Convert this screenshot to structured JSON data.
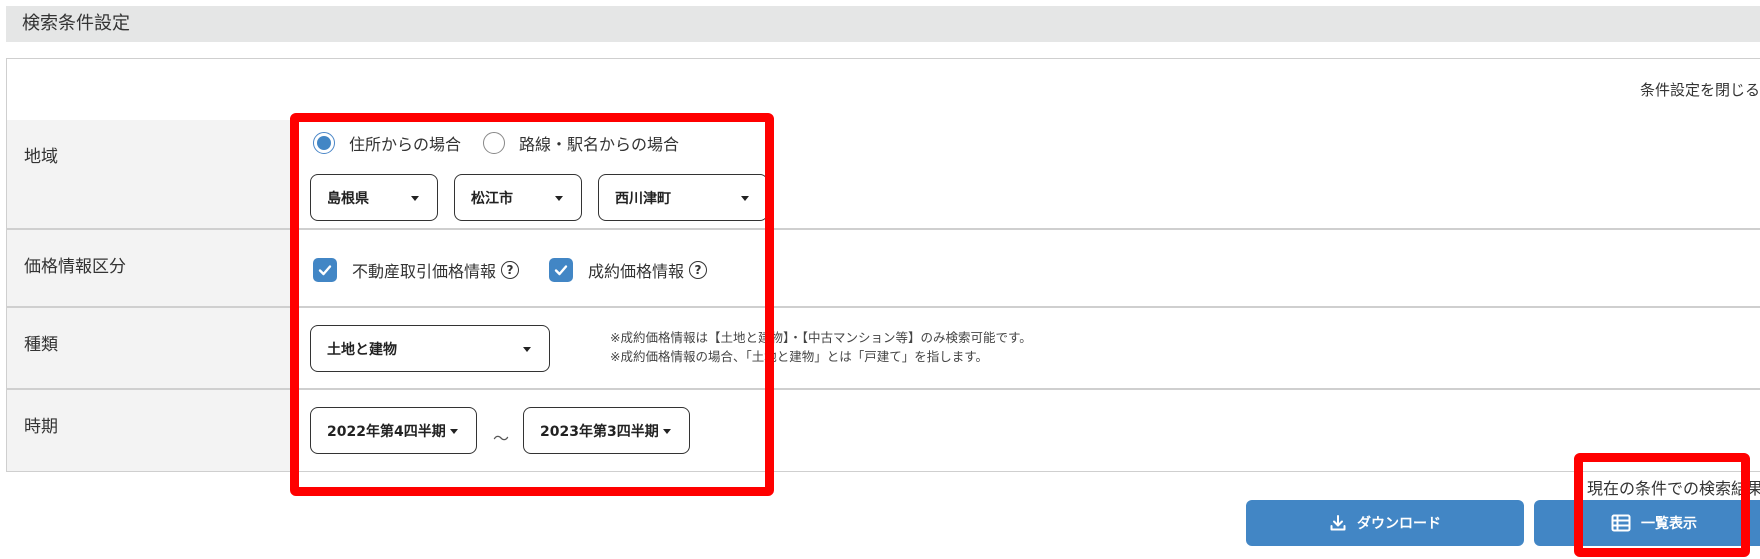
{
  "section": {
    "title": "検索条件設定",
    "toggle_label": "条件設定を閉じる"
  },
  "region": {
    "label": "地域",
    "radio_options": [
      {
        "label": "住所からの場合",
        "checked": true
      },
      {
        "label": "路線・駅名からの場合",
        "checked": false
      }
    ],
    "prefecture": "島根県",
    "city": "松江市",
    "district": "西川津町"
  },
  "price_category": {
    "label": "価格情報区分",
    "options": [
      {
        "label": "不動産取引価格情報",
        "checked": true,
        "help_icon": "question-circle-icon"
      },
      {
        "label": "成約価格情報",
        "checked": true,
        "help_icon": "question-circle-icon"
      }
    ]
  },
  "type": {
    "label": "種類",
    "selected": "土地と建物",
    "notes": [
      "※成約価格情報は【土地と建物】・【中古マンション等】のみ検索可能です。",
      "※成約価格情報の場合、「土地と建物」とは「戸建て」を指します。"
    ]
  },
  "period": {
    "label": "時期",
    "from": "2022年第4四半期",
    "separator": "～",
    "to": "2023年第3四半期"
  },
  "actions": {
    "result_text": "現在の条件での検索結果",
    "download_label": "ダウンロード",
    "download_icon": "download-icon",
    "list_label": "一覧表示",
    "list_icon": "list-table-icon"
  },
  "colors": {
    "accent": "#4286c5",
    "header_bg": "#e5e6e6",
    "label_bg": "#f3f3f3",
    "annotation": "#ff0000"
  }
}
